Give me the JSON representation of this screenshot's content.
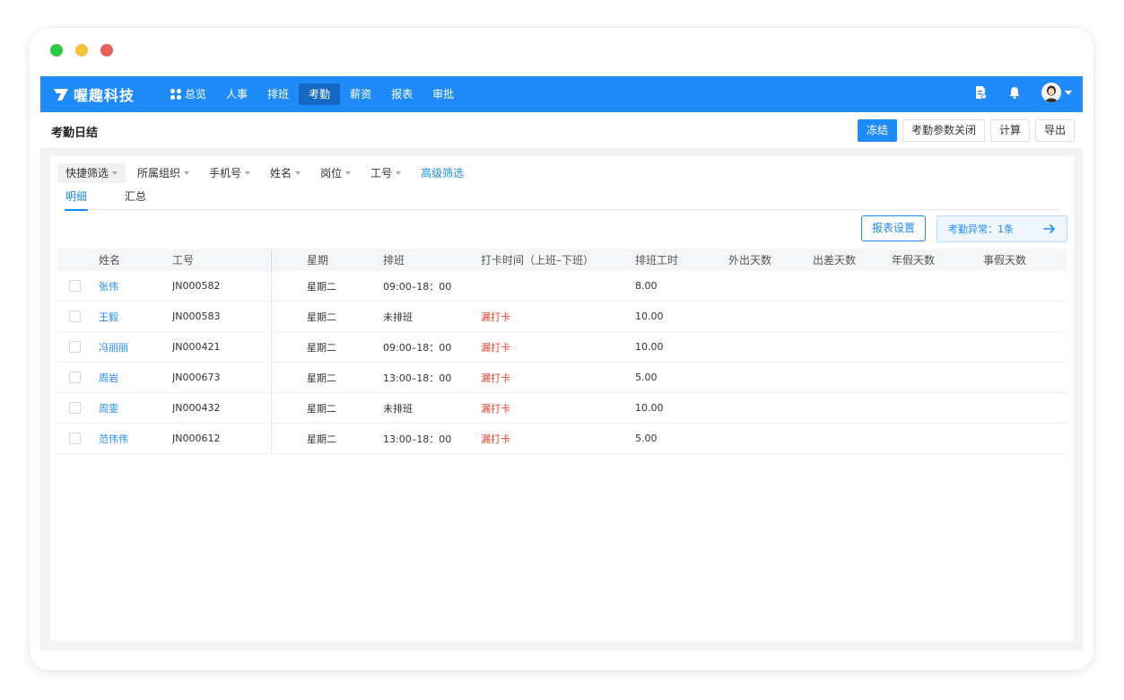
{
  "brand": {
    "name": "喔趣科技"
  },
  "nav": {
    "items": [
      {
        "label": "总览",
        "has_icon": true,
        "active": false
      },
      {
        "label": "人事",
        "active": false
      },
      {
        "label": "排班",
        "active": false
      },
      {
        "label": "考勤",
        "active": true
      },
      {
        "label": "薪资",
        "active": false
      },
      {
        "label": "报表",
        "active": false
      },
      {
        "label": "审批",
        "active": false
      }
    ]
  },
  "page": {
    "title": "考勤日结"
  },
  "actions": {
    "freeze": "冻结",
    "param_close": "考勤参数关闭",
    "calc": "计算",
    "export": "导出"
  },
  "filters": {
    "quick": "快捷筛选",
    "org": "所属组织",
    "phone": "手机号",
    "name": "姓名",
    "post": "岗位",
    "empno": "工号",
    "advanced": "高级筛选"
  },
  "tabs": {
    "detail": "明细",
    "summary": "汇总"
  },
  "report_settings": "报表设置",
  "alert": {
    "text": "考勤异常：1条"
  },
  "table": {
    "headers": {
      "name": "姓名",
      "id": "工号",
      "week": "星期",
      "sched": "排班",
      "punch": "打卡时间（上班–下班）",
      "hours": "排班工时",
      "out": "外出天数",
      "trip": "出差天数",
      "annual": "年假天数",
      "pers": "事假天数"
    },
    "rows": [
      {
        "name": "张伟",
        "id": "JN000582",
        "week": "星期二",
        "sched": "09:00–18：00",
        "punch": "",
        "hours": "8.00"
      },
      {
        "name": "王毅",
        "id": "JN000583",
        "week": "星期二",
        "sched": "未排班",
        "punch": "漏打卡",
        "hours": "10.00"
      },
      {
        "name": "冯丽丽",
        "id": "JN000421",
        "week": "星期二",
        "sched": "09:00–18：00",
        "punch": "漏打卡",
        "hours": "10.00"
      },
      {
        "name": "周岩",
        "id": "JN000673",
        "week": "星期二",
        "sched": "13:00–18：00",
        "punch": "漏打卡",
        "hours": "5.00"
      },
      {
        "name": "周雯",
        "id": "JN000432",
        "week": "星期二",
        "sched": "未排班",
        "punch": "漏打卡",
        "hours": "10.00"
      },
      {
        "name": "范伟伟",
        "id": "JN000612",
        "week": "星期二",
        "sched": "13:00–18：00",
        "punch": "漏打卡",
        "hours": "5.00"
      }
    ]
  },
  "icons": {
    "report": "report-doc-icon",
    "bell": "bell-icon",
    "avatar": "user-avatar",
    "arrow": "arrow-right-icon"
  },
  "colors": {
    "primary": "#1e8bf8",
    "danger": "#e8432f",
    "nav_active": "#1568c4"
  }
}
